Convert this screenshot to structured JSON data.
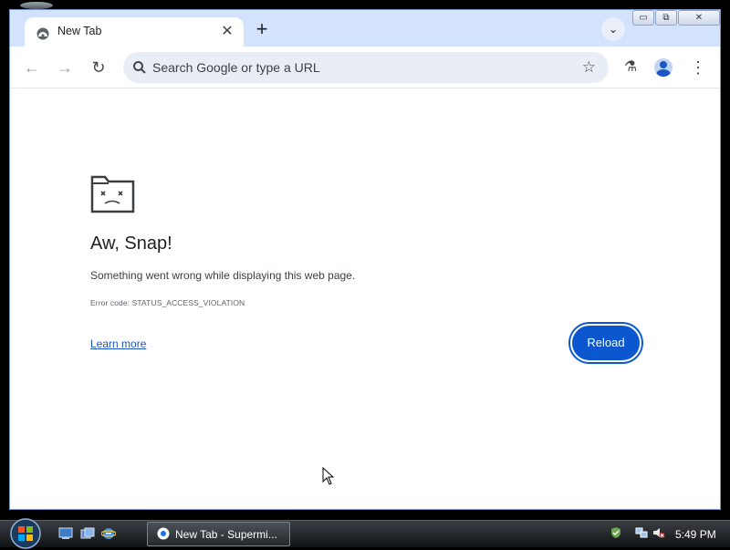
{
  "browser": {
    "tab": {
      "title": "New Tab",
      "close_glyph": "✕",
      "favicon": "crash-favicon-icon"
    },
    "new_tab_glyph": "+",
    "tab_search_glyph": "⌄",
    "window_controls": {
      "minimize": "▭",
      "restore": "⧉",
      "close": "✕"
    },
    "toolbar": {
      "back_glyph": "←",
      "forward_glyph": "→",
      "reload_glyph": "↻",
      "omnibox_placeholder": "Search Google or type a URL",
      "bookmark_glyph": "☆",
      "labs_glyph": "⚗",
      "menu_glyph": "⋮"
    }
  },
  "error_page": {
    "title": "Aw, Snap!",
    "message": "Something went wrong while displaying this web page.",
    "error_code": "Error code: STATUS_ACCESS_VIOLATION",
    "learn_more": "Learn more",
    "reload_label": "Reload"
  },
  "taskbar": {
    "task_label": "New Tab - Supermi...",
    "clock": "5:49 PM"
  },
  "colors": {
    "accent": "#0b57d0",
    "tabstrip": "#d3e3fd",
    "link": "#1a57c2"
  }
}
